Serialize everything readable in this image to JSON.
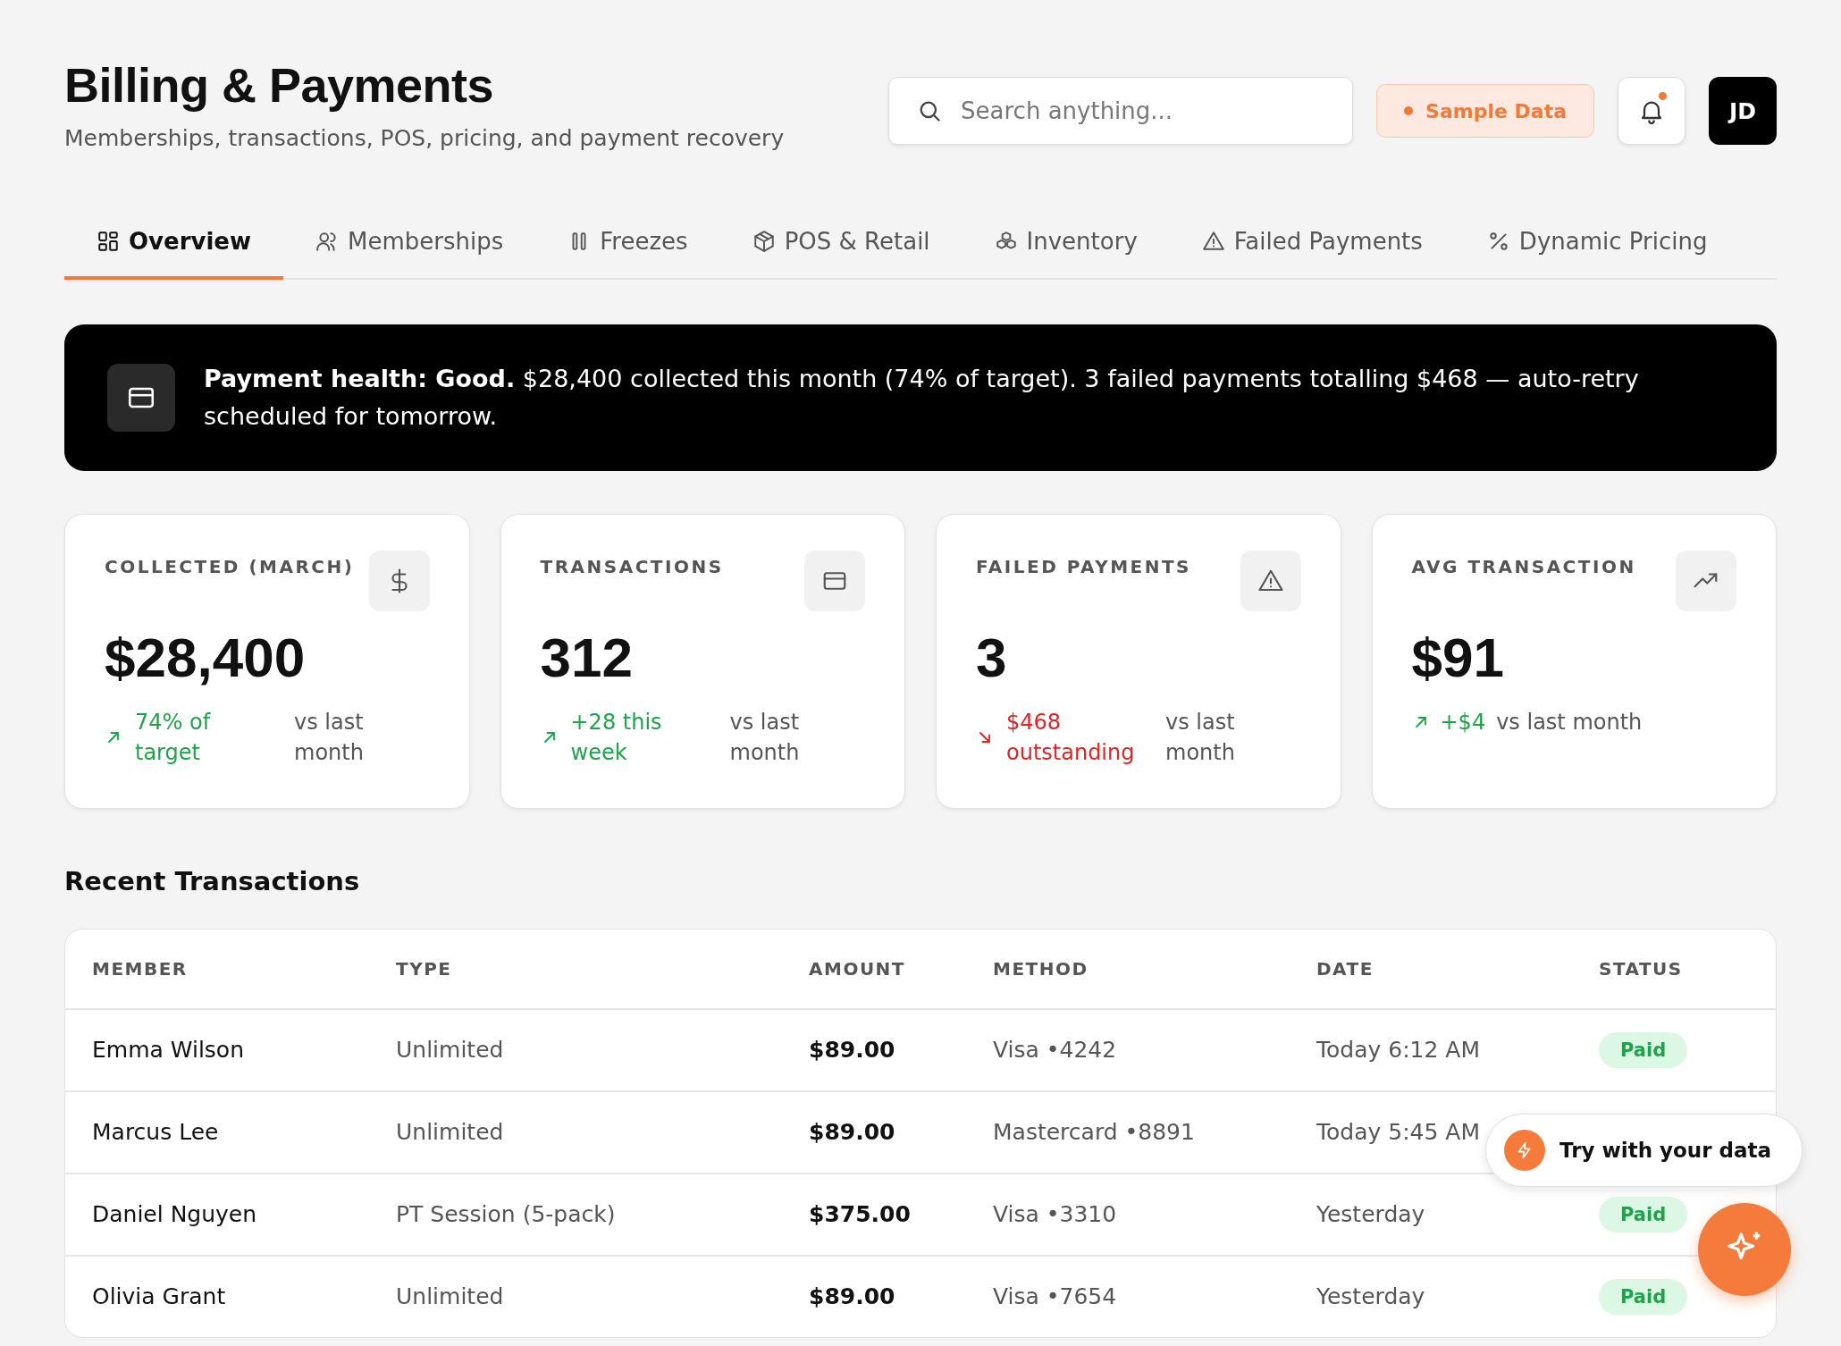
{
  "header": {
    "title": "Billing & Payments",
    "subtitle": "Memberships, transactions, POS, pricing, and payment recovery"
  },
  "search": {
    "placeholder": "Search anything..."
  },
  "sample_badge": {
    "label": "Sample Data"
  },
  "notifications": {
    "unread": true
  },
  "avatar": {
    "initials": "JD"
  },
  "tabs": [
    {
      "label": "Overview",
      "selected": true
    },
    {
      "label": "Memberships",
      "selected": false
    },
    {
      "label": "Freezes",
      "selected": false
    },
    {
      "label": "POS & Retail",
      "selected": false
    },
    {
      "label": "Inventory",
      "selected": false
    },
    {
      "label": "Failed Payments",
      "selected": false
    },
    {
      "label": "Dynamic Pricing",
      "selected": false
    }
  ],
  "banner": {
    "text": "**Payment health: Good.** $28,400 collected this month (74% of target). 3 failed payments totalling $468 — auto-retry scheduled for tomorrow."
  },
  "stats": [
    {
      "label": "COLLECTED (MARCH)",
      "value": "$28,400",
      "kind": "up",
      "delta": "74% of target",
      "note": "vs last month"
    },
    {
      "label": "TRANSACTIONS",
      "value": "312",
      "kind": "up",
      "delta": "+28 this week",
      "note": "vs last month"
    },
    {
      "label": "FAILED PAYMENTS",
      "value": "3",
      "kind": "down",
      "delta": "$468 outstanding",
      "note": "vs last month"
    },
    {
      "label": "AVG TRANSACTION",
      "value": "$91",
      "kind": "up",
      "delta": "+$4",
      "note": "vs last month"
    }
  ],
  "transactions": {
    "title": "Recent Transactions",
    "columns": [
      "MEMBER",
      "TYPE",
      "AMOUNT",
      "METHOD",
      "DATE",
      "STATUS"
    ],
    "rows": [
      {
        "member": "Emma Wilson",
        "type": "Unlimited",
        "amount": "$89.00",
        "method": "Visa •4242",
        "date": "Today 6:12 AM",
        "status": "Paid"
      },
      {
        "member": "Marcus Lee",
        "type": "Unlimited",
        "amount": "$89.00",
        "method": "Mastercard •8891",
        "date": "Today 5:45 AM"
      },
      {
        "member": "Daniel Nguyen",
        "type": "PT Session (5-pack)",
        "amount": "$375.00",
        "method": "Visa •3310",
        "date": "Yesterday",
        "status": "Paid"
      },
      {
        "member": "Olivia Grant",
        "type": "Unlimited",
        "amount": "$89.00",
        "method": "Visa •7654",
        "date": "Yesterday",
        "status": "Paid"
      }
    ]
  },
  "try_popup": {
    "label": "Try with your data"
  }
}
